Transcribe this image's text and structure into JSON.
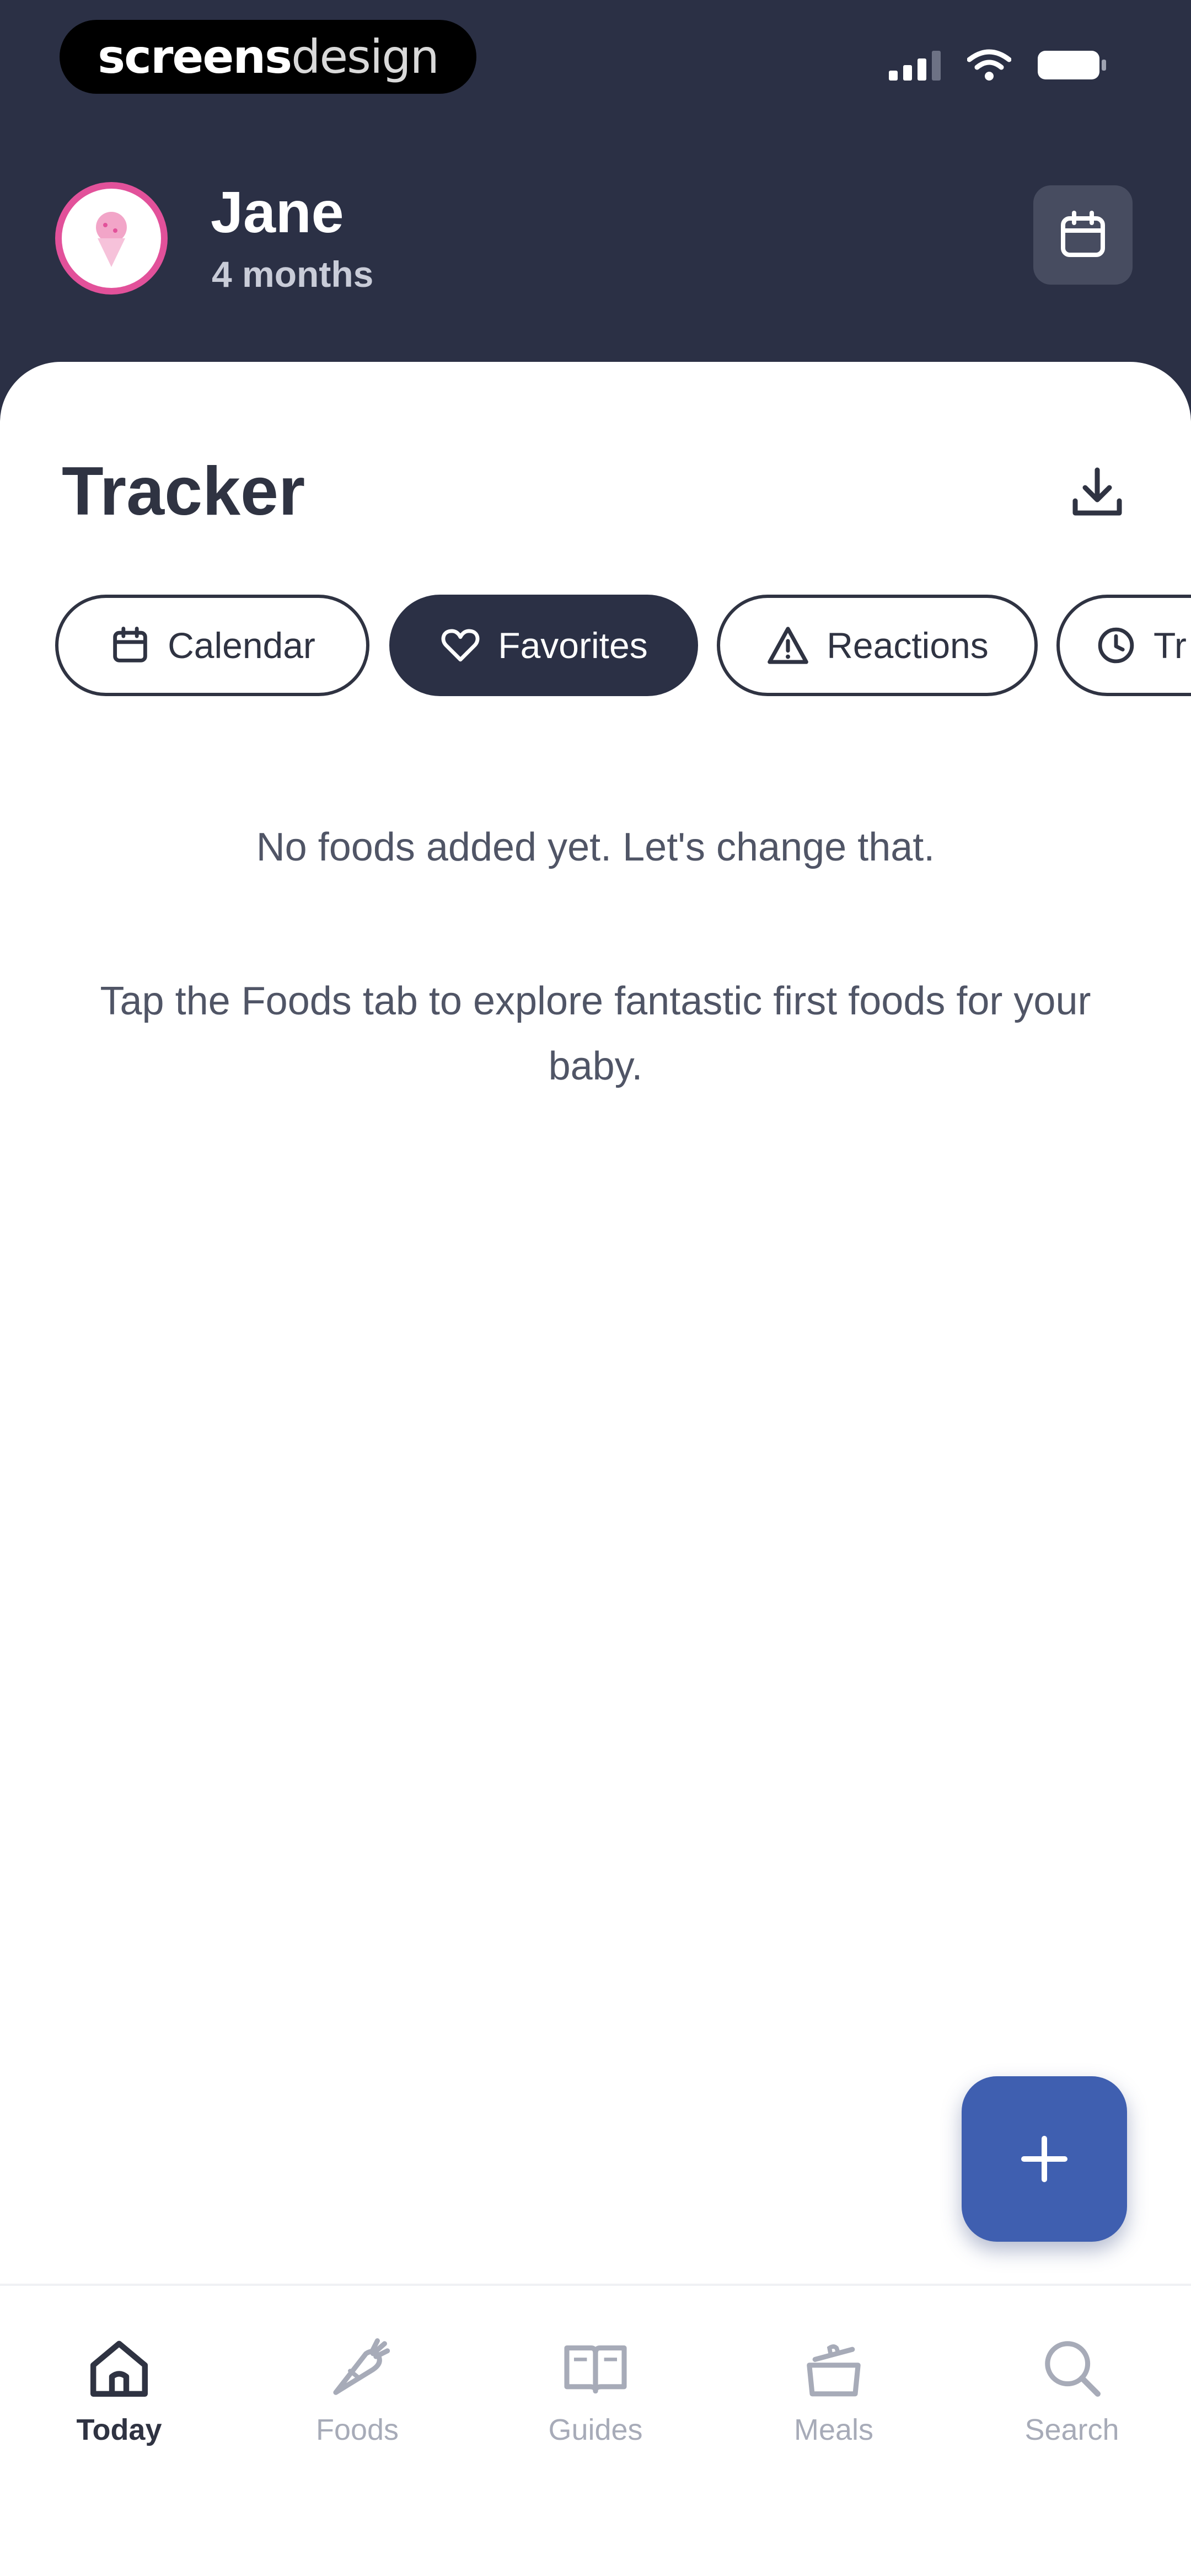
{
  "status_bar": {
    "watermark_bold": "screens",
    "watermark_light": "design"
  },
  "header": {
    "name": "Jane",
    "age": "4 months"
  },
  "tracker": {
    "title": "Tracker",
    "chips": [
      {
        "label": "Calendar",
        "icon": "calendar-icon",
        "active": false
      },
      {
        "label": "Favorites",
        "icon": "heart-icon",
        "active": true
      },
      {
        "label": "Reactions",
        "icon": "warning-icon",
        "active": false
      },
      {
        "label": "Tr",
        "icon": "clock-icon",
        "active": false
      }
    ],
    "empty_title": "No foods added yet. Let's change that.",
    "empty_description": "Tap the Foods tab to explore fantastic first foods for your baby."
  },
  "bottom_nav": {
    "items": [
      {
        "label": "Today",
        "icon": "home-icon",
        "active": true
      },
      {
        "label": "Foods",
        "icon": "carrot-icon",
        "active": false
      },
      {
        "label": "Guides",
        "icon": "book-icon",
        "active": false
      },
      {
        "label": "Meals",
        "icon": "pot-icon",
        "active": false
      },
      {
        "label": "Search",
        "icon": "search-icon",
        "active": false
      }
    ]
  },
  "colors": {
    "header_bg": "#2b3045",
    "card_bg": "#ffffff",
    "text_dark": "#2f3342",
    "text_muted": "#505566",
    "avatar_ring": "#e2519a",
    "fab_bg": "#3f5fb0",
    "nav_inactive": "#a7abb8"
  }
}
